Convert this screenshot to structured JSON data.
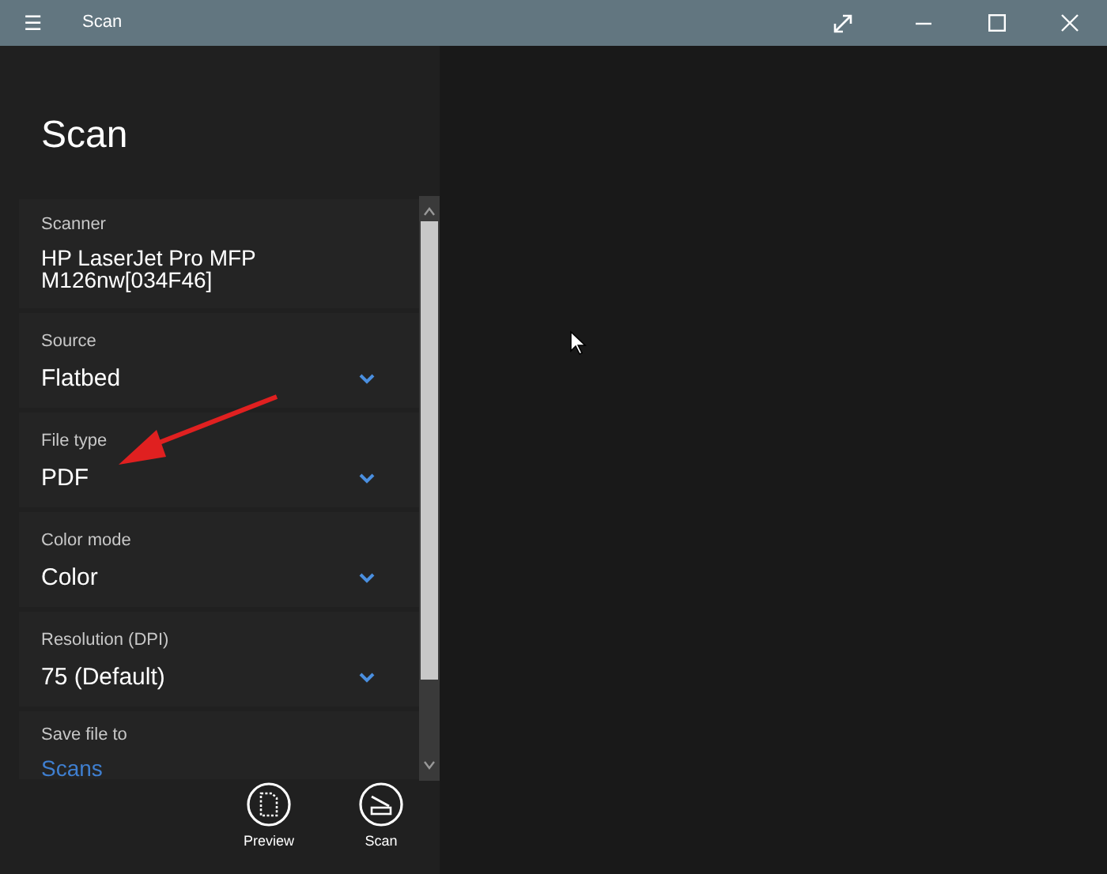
{
  "window": {
    "title": "Scan",
    "menu_glyph": "☰"
  },
  "panel_title": "Scan",
  "settings": [
    {
      "kind": "info",
      "label": "Scanner",
      "value": "HP LaserJet Pro MFP M126nw[034F46]"
    },
    {
      "kind": "dropdown",
      "label": "Source",
      "value": "Flatbed"
    },
    {
      "kind": "dropdown",
      "label": "File type",
      "value": "PDF"
    },
    {
      "kind": "dropdown",
      "label": "Color mode",
      "value": "Color"
    },
    {
      "kind": "dropdown",
      "label": "Resolution (DPI)",
      "value": "75 (Default)"
    },
    {
      "kind": "link",
      "label": "Save file to",
      "value": "Scans"
    }
  ],
  "actions": [
    {
      "kind": "preview",
      "label": "Preview"
    },
    {
      "kind": "scan",
      "label": "Scan"
    }
  ]
}
